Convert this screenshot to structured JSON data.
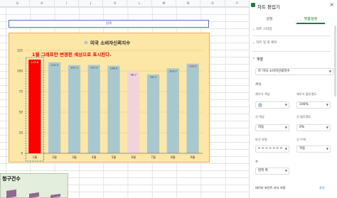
{
  "sheet": {
    "columns": [
      "G",
      "H",
      "I",
      "J",
      "K",
      "L",
      "M",
      "N",
      "O",
      "P"
    ],
    "legend_label": "범례"
  },
  "chart_data": {
    "type": "bar",
    "title": "미국 소비자신뢰지수",
    "annotation": "1월 그래프만 변경된 색상으로 표시된다.",
    "categories": [
      "1월",
      "2월",
      "3월",
      "4월",
      "5월",
      "6월",
      "7월",
      "8월",
      "9월"
    ],
    "series": [
      {
        "name": "미국 소비자신뢰지수",
        "values": [
          113.8,
          110.5,
          107.2,
          107.3,
          106.4,
          98.7,
          95.7,
          103.2,
          108.9
        ]
      }
    ],
    "data_labels": [
      "113.8",
      "110.5",
      "107.2",
      "107.3",
      "106.4",
      "98.7",
      "95.7",
      "103.2",
      "108.9"
    ],
    "ylim": [
      0,
      125
    ],
    "yticks": [
      0,
      25,
      50,
      75,
      100,
      125
    ],
    "grid": true,
    "legend_position": "top",
    "colors": {
      "default": "#a8c8d0",
      "highlight": "#ff0000",
      "june": "#f1d3dd",
      "background": "#fde7a7",
      "border": "#f0a85c",
      "title_red": "#ff0000"
    }
  },
  "chart2": {
    "title": "청구건수"
  },
  "panel": {
    "title": "차트 편집기",
    "close": "×",
    "tabs": [
      "설정",
      "맞춤설정"
    ],
    "sections": {
      "chart_style": "차트 스타일",
      "chart_axis_title": "차트 및 축 제목",
      "series": "계열"
    },
    "series_select": "미국 소비자신뢰지수",
    "format_label": "서식",
    "fill_color_label": "채우기 색상",
    "fill_opacity_label": "채우기 불투명도",
    "fill_opacity_value": "100%",
    "line_color_label": "선 색상",
    "line_opacity_label": "선 불투명도",
    "line_color_value": "자동",
    "line_opacity_value": "0%",
    "dash_type_label": "파선 유형",
    "line_thickness_label": "선 두께",
    "line_thickness_value": "자동",
    "axis_label": "축",
    "axis_value": "왼쪽 축",
    "data_point_label": "데이터 포인트 서식 지정",
    "add_button": "추가"
  }
}
